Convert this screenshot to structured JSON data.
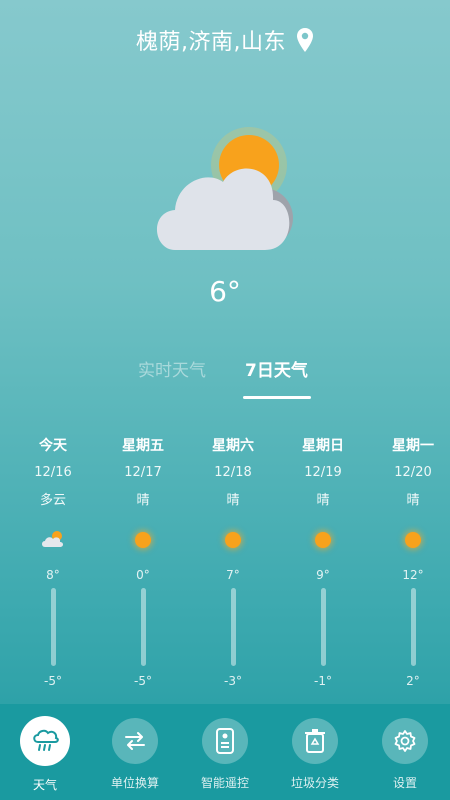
{
  "header": {
    "location": "槐荫,济南,山东",
    "pin_icon": "location-pin-icon"
  },
  "current": {
    "temperature": "6°",
    "condition_icon": "partly-cloudy-icon"
  },
  "tabs": [
    {
      "label": "实时天气",
      "active": false
    },
    {
      "label": "7日天气",
      "active": true
    }
  ],
  "forecast": [
    {
      "day": "今天",
      "date": "12/16",
      "condition": "多云",
      "icon": "cloud-sun-icon",
      "high": "8°",
      "low": "-5°"
    },
    {
      "day": "星期五",
      "date": "12/17",
      "condition": "晴",
      "icon": "sun-icon",
      "high": "0°",
      "low": "-5°"
    },
    {
      "day": "星期六",
      "date": "12/18",
      "condition": "晴",
      "icon": "sun-icon",
      "high": "7°",
      "low": "-3°"
    },
    {
      "day": "星期日",
      "date": "12/19",
      "condition": "晴",
      "icon": "sun-icon",
      "high": "9°",
      "low": "-1°"
    },
    {
      "day": "星期一",
      "date": "12/20",
      "condition": "晴",
      "icon": "sun-icon",
      "high": "12°",
      "low": "2°"
    }
  ],
  "nav": [
    {
      "label": "天气",
      "icon": "weather-icon",
      "active": true
    },
    {
      "label": "单位换算",
      "icon": "swap-arrows-icon",
      "active": false
    },
    {
      "label": "智能遥控",
      "icon": "remote-control-icon",
      "active": false
    },
    {
      "label": "垃圾分类",
      "icon": "trash-bin-icon",
      "active": false
    },
    {
      "label": "设置",
      "icon": "gear-icon",
      "active": false
    }
  ],
  "colors": {
    "accent": "#1a9aa0",
    "sun": "#f8a21c",
    "cloud": "#dfe3ea"
  }
}
